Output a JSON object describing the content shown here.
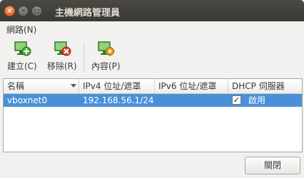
{
  "window": {
    "title": "主機網路管理員"
  },
  "menubar": {
    "items": [
      {
        "label": "網路(N)"
      }
    ]
  },
  "toolbar": {
    "create_label": "建立(C)",
    "remove_label": "移除(R)",
    "properties_label": "內容(P)",
    "icons": {
      "create": "add-network-icon",
      "remove": "remove-network-icon",
      "properties": "network-properties-icon"
    },
    "colors": {
      "green": "#4fa83d",
      "red": "#d9412f",
      "orange": "#e8a21e"
    }
  },
  "table": {
    "columns": [
      "名稱",
      "IPv4 位址/遮罩",
      "IPv6 位址/遮罩",
      "DHCP 伺服器"
    ],
    "rows": [
      {
        "name": "vboxnet0",
        "ipv4": "192.168.56.1/24",
        "ipv6": "",
        "dhcp_checked": true,
        "dhcp_label": "啟用"
      }
    ],
    "selection_color": "#4a90d9"
  },
  "footer": {
    "close_label": "關閉"
  }
}
